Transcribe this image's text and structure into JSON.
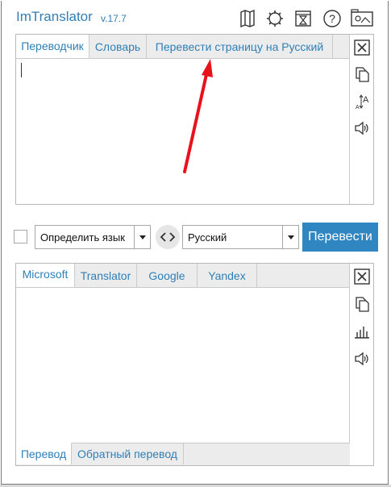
{
  "header": {
    "title": "ImTranslator",
    "version": "v.17.7",
    "icons": [
      "map-icon",
      "settings-icon",
      "history-icon",
      "help-icon",
      "screen-icon"
    ]
  },
  "source": {
    "tabs": [
      "Переводчик",
      "Словарь",
      "Перевести страницу на Русский"
    ],
    "active_tab": 0,
    "text_value": "",
    "side_icons": [
      "close-icon",
      "copy-icon",
      "font-size-icon",
      "speaker-icon"
    ]
  },
  "controls": {
    "detect_label": "Определить язык",
    "target_lang": "Русский",
    "translate_label": "Перевести"
  },
  "result": {
    "tabs": [
      "Microsoft",
      "Translator",
      "Google",
      "Yandex"
    ],
    "active_tab": 0,
    "bottom_tabs": [
      "Перевод",
      "Обратный перевод"
    ],
    "bottom_active": 0,
    "side_icons": [
      "close-icon",
      "copy-icon",
      "chart-icon",
      "speaker-icon"
    ]
  },
  "colors": {
    "accent": "#2f7fb8",
    "button": "#2f86c1",
    "annotation": "#e8121b"
  }
}
